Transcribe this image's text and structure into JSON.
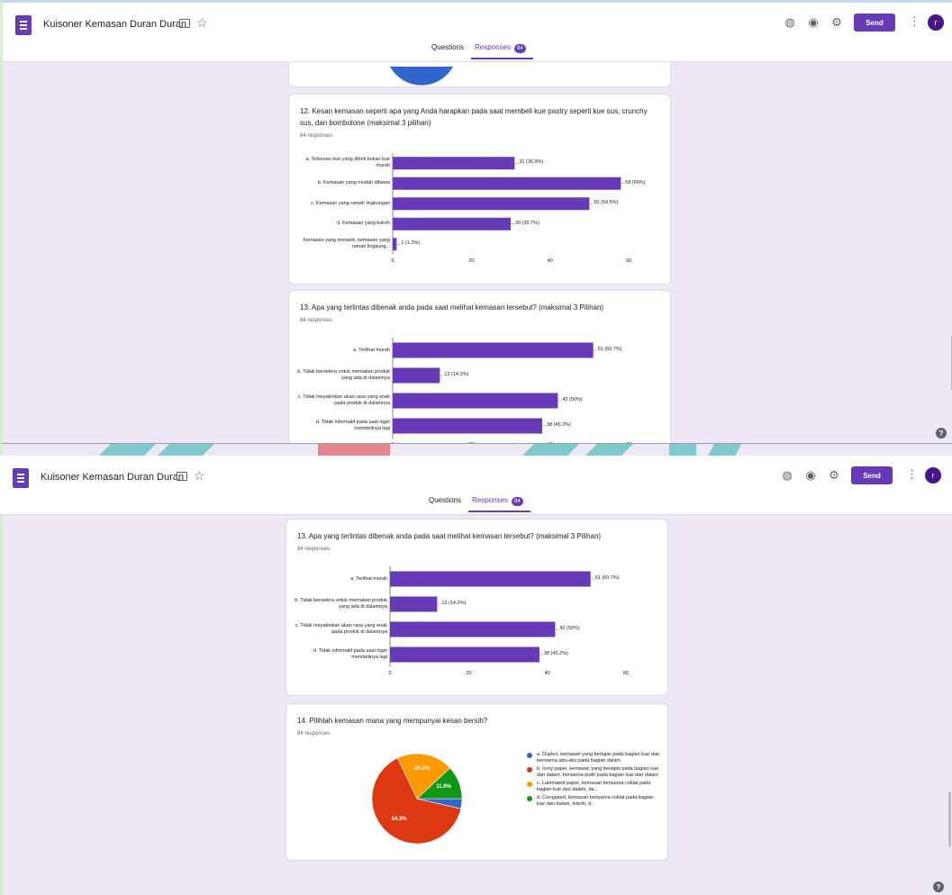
{
  "header": {
    "title": "Kuisoner Kemasan Duran Duran",
    "send_label": "Send",
    "avatar_letter": "r",
    "tabs": {
      "questions": "Questions",
      "responses": "Responses",
      "responses_badge": "84"
    }
  },
  "help_label": "?",
  "colors": {
    "accent": "#673ab7",
    "bar": "#673ab7",
    "pie_blue": "#3366cc",
    "pie_red": "#dc3912",
    "pie_orange": "#ff9900",
    "pie_green": "#109618"
  },
  "q12": {
    "title": "12. Kesan kemasan seperti apa yang Anda harapkan pada saat membeli kue pastry seperti kue sus, crunchy sus, dan bombolone (maksimal 3 pilihan)",
    "count": "84 responses"
  },
  "q13": {
    "title": "13. Apa yang terlintas dibenak anda pada saat melihat kemasan tersebut? (maksimal 3 Pilihan)",
    "count": "84 responses"
  },
  "q14": {
    "title": "14. Pilihlah kemasan mana yang mempunyai kesan bersih?",
    "count": "84 responses"
  },
  "chart_data": [
    {
      "type": "bar",
      "orientation": "horizontal",
      "categories": [
        "a. Terkesan kue yang dibeli bukan kue murah",
        "b. Kemasan yang mudah dibawa",
        "c. Kemasan yang ramah lingkungan",
        "d. Kemasan yang kokoh",
        "Kemasan yang menarik, kemasan yang ramah lingkung..."
      ],
      "values": [
        31,
        58,
        50,
        30,
        1
      ],
      "data_labels": [
        "31 (36.9%)",
        "58 (69%)",
        "50 (59.5%)",
        "30 (35.7%)",
        "1 (1.2%)"
      ],
      "xlim": [
        0,
        60
      ],
      "xticks": [
        "0",
        "20",
        "40",
        "60"
      ]
    },
    {
      "type": "bar",
      "orientation": "horizontal",
      "categories": [
        "a. Terlihat murah",
        "b. Tidak berselera untuk memakan produk yang ada di dalamnya",
        "c. Tidak meyakinkan akan rasa yang enak pada produk di dalamnya",
        "d. Tidak informatif pada saat ingin membelinya lagi"
      ],
      "values": [
        51,
        12,
        42,
        38
      ],
      "data_labels": [
        "51 (60.7%)",
        "12 (14.3%)",
        "42 (50%)",
        "38 (45.2%)"
      ],
      "xlim": [
        0,
        60
      ],
      "xticks": [
        "0",
        "20",
        "40",
        "60"
      ]
    },
    {
      "type": "pie",
      "categories": [
        "a. Duplex, kemasan yang berlapis pada bagian luar dan berwarna abu-abu pada bagian dalam",
        "b. Ivory paper, kemasan yang berlapis pada bagian luar dan dalam, berwarna putih pada bagian luar dan dalam",
        "c. Laminated paper, kemasan berwarna coklat pada bagian luar dan dalam, da...",
        "d. Corugated, kemasan berwarna coklat pada bagian luar dan dalam, kokoh, d..."
      ],
      "values": [
        3.6,
        64.3,
        20.2,
        11.9
      ],
      "slice_labels": [
        "",
        "64.3%",
        "20.2%",
        "11.9%"
      ],
      "legend": "right"
    }
  ]
}
